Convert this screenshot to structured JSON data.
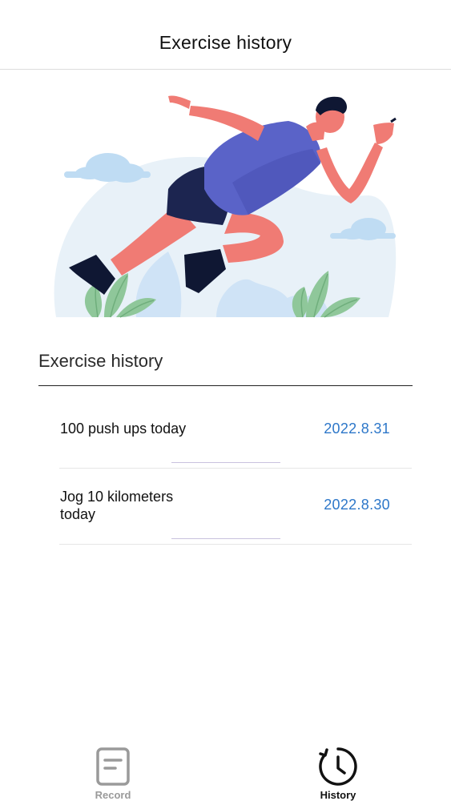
{
  "nav": {
    "title": "Exercise history"
  },
  "hero": {
    "illustration": "runner-sprinting-illustration"
  },
  "section": {
    "title": "Exercise history"
  },
  "history": [
    {
      "text": "100 push ups today",
      "date": "2022.8.31"
    },
    {
      "text": "Jog 10 kilometers today",
      "date": "2022.8.30"
    }
  ],
  "tabs": [
    {
      "label": "Record",
      "icon": "document-icon",
      "active": false
    },
    {
      "label": "History",
      "icon": "clock-history-icon",
      "active": true
    }
  ],
  "colors": {
    "date_text": "#2d77c9",
    "active_tab": "#111111",
    "inactive_tab": "#9a9a9a",
    "skin": "#f07b74",
    "shirt": "#5a63c8",
    "shorts": "#1c2550",
    "foliage": "#8fc79a",
    "cloud": "#bfdcf3"
  }
}
